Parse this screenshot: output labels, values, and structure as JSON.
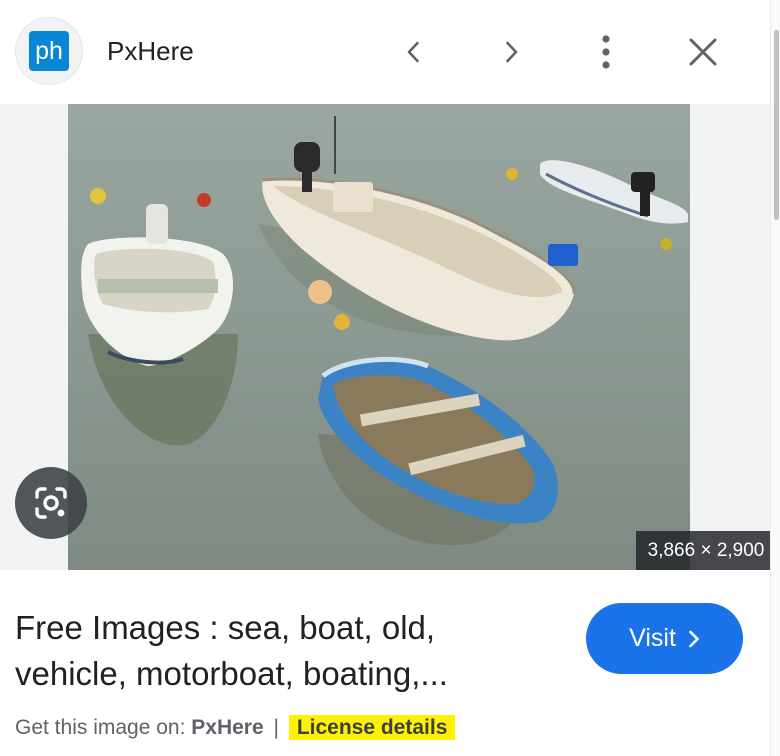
{
  "header": {
    "site_icon_text": "ph",
    "site_name": "PxHere",
    "prev_icon": "chevron-left-icon",
    "next_icon": "chevron-right-icon",
    "more_icon": "more-vert-icon",
    "close_icon": "close-icon"
  },
  "image": {
    "description_icon": "google-lens-icon",
    "dimensions": "3,866 × 2,900"
  },
  "caption": {
    "title_line1": "Free Images : sea, boat, old,",
    "title_line2": "vehicle, motorboat, boating,...",
    "visit_label": "Visit",
    "visit_icon": "chevron-right-icon",
    "source_prefix": "Get this image on:",
    "source_site": "PxHere",
    "separator": "|",
    "license_label": "License details"
  },
  "colors": {
    "accent": "#1a73e8",
    "highlight": "#fff200",
    "site_icon_bg": "#0a86d6"
  }
}
